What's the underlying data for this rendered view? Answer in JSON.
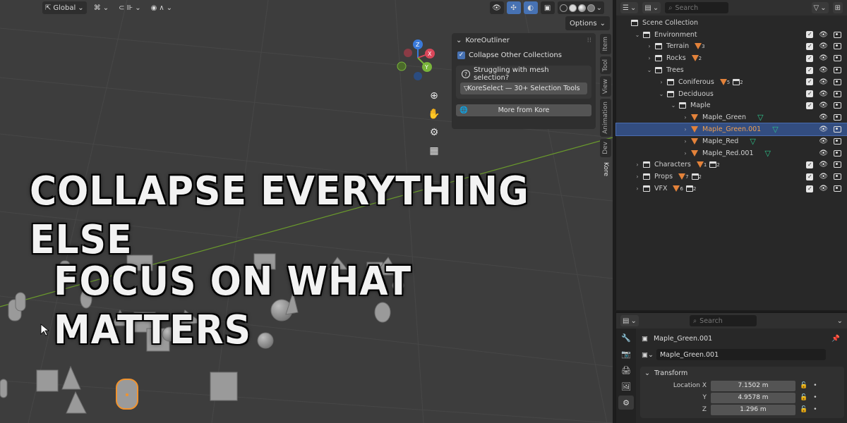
{
  "viewport": {
    "header": {
      "orientation": "Global",
      "options_label": "Options"
    }
  },
  "n_panel": {
    "title": "KoreOutliner",
    "collapse_label": "Collapse Other Collections",
    "question_text": "Struggling with mesh selection?",
    "koreselect_label": "KoreSelect — 30+ Selection Tools",
    "more_label": "More from Kore",
    "tabs": [
      "Item",
      "Tool",
      "View",
      "Animation",
      "Dev",
      "Kore"
    ]
  },
  "headline": {
    "line1": "COLLAPSE EVERYTHING ELSE",
    "line2": "FOCUS ON WHAT MATTERS"
  },
  "outliner": {
    "search_placeholder": "Search",
    "rows": [
      {
        "label": "Scene Collection",
        "indent": 0,
        "type": "scene"
      },
      {
        "label": "Environment",
        "indent": 1,
        "type": "collection",
        "arrow": "open"
      },
      {
        "label": "Terrain",
        "indent": 2,
        "type": "collection",
        "arrow": "closed",
        "badges": [
          {
            "kind": "mesh",
            "count": "3"
          }
        ]
      },
      {
        "label": "Rocks",
        "indent": 2,
        "type": "collection",
        "arrow": "closed",
        "badges": [
          {
            "kind": "mesh",
            "count": "2"
          }
        ]
      },
      {
        "label": "Trees",
        "indent": 2,
        "type": "collection",
        "arrow": "open"
      },
      {
        "label": "Coniferous",
        "indent": 3,
        "type": "collection",
        "arrow": "closed",
        "badges": [
          {
            "kind": "mesh",
            "count": "5"
          },
          {
            "kind": "coll",
            "count": "2"
          }
        ]
      },
      {
        "label": "Deciduous",
        "indent": 3,
        "type": "collection",
        "arrow": "open"
      },
      {
        "label": "Maple",
        "indent": 4,
        "type": "collection",
        "arrow": "open"
      },
      {
        "label": "Maple_Green",
        "indent": 5,
        "type": "object",
        "arrow": "closed",
        "data": true
      },
      {
        "label": "Maple_Green.001",
        "indent": 5,
        "type": "object",
        "arrow": "closed",
        "data": true,
        "selected": true
      },
      {
        "label": "Maple_Red",
        "indent": 5,
        "type": "object",
        "arrow": "closed",
        "data": true
      },
      {
        "label": "Maple_Red.001",
        "indent": 5,
        "type": "object",
        "arrow": "closed",
        "data": true
      },
      {
        "label": "Characters",
        "indent": 1,
        "type": "collection",
        "arrow": "closed",
        "badges": [
          {
            "kind": "mesh",
            "count": "1"
          },
          {
            "kind": "coll",
            "count": "2"
          }
        ]
      },
      {
        "label": "Props",
        "indent": 1,
        "type": "collection",
        "arrow": "closed",
        "badges": [
          {
            "kind": "mesh",
            "count": "7"
          },
          {
            "kind": "coll",
            "count": "2"
          }
        ]
      },
      {
        "label": "VFX",
        "indent": 1,
        "type": "collection",
        "arrow": "closed",
        "badges": [
          {
            "kind": "mesh",
            "count": "6"
          },
          {
            "kind": "coll",
            "count": "2"
          }
        ]
      }
    ]
  },
  "properties": {
    "search_placeholder": "Search",
    "object_name": "Maple_Green.001",
    "name_field": "Maple_Green.001",
    "transform_title": "Transform",
    "location": [
      {
        "axis": "Location X",
        "value": "7.1502 m"
      },
      {
        "axis": "Y",
        "value": "4.9578 m"
      },
      {
        "axis": "Z",
        "value": "1.296 m"
      }
    ]
  },
  "colors": {
    "accent_blue": "#4772b3",
    "selection_orange": "#e3823a",
    "mesh_data_green": "#2ec48c",
    "x_axis_red": "#d9475a",
    "y_axis_green": "#79b53b",
    "z_axis_blue": "#3a7ad9"
  }
}
